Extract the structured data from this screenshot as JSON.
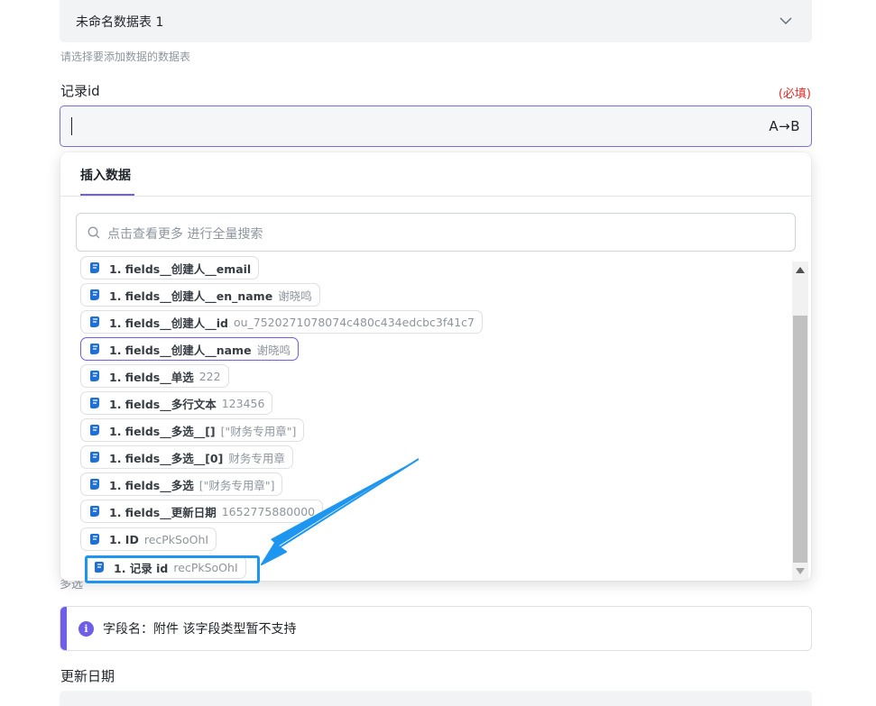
{
  "table_select": {
    "value": "未命名数据表 1",
    "hint": "请选择要添加数据的数据表"
  },
  "record_field": {
    "label": "记录id",
    "required": "(必填)",
    "value": "",
    "transform_label": "A→B"
  },
  "dropdown": {
    "tab": "插入数据",
    "search_placeholder": "点击查看更多 进行全量搜索",
    "items": [
      {
        "name": "1. fields__创建人__email",
        "value": ""
      },
      {
        "name": "1. fields__创建人__en_name",
        "value": "谢晓鸣"
      },
      {
        "name": "1. fields__创建人__id",
        "value": "ou_7520271078074c480c434edcbc3f41c7"
      },
      {
        "name": "1. fields__创建人__name",
        "value": "谢晓鸣"
      },
      {
        "name": "1. fields__单选",
        "value": "222"
      },
      {
        "name": "1. fields__多行文本",
        "value": "123456"
      },
      {
        "name": "1. fields__多选__[]",
        "value": "[\"财务专用章\"]"
      },
      {
        "name": "1. fields__多选__[0]",
        "value": "财务专用章"
      },
      {
        "name": "1. fields__多选",
        "value": "[\"财务专用章\"]"
      },
      {
        "name": "1. fields__更新日期",
        "value": "1652775880000"
      },
      {
        "name": "1. ID",
        "value": "recPkSoOhI"
      },
      {
        "name": "1. 记录 id",
        "value": "recPkSoOhI"
      }
    ]
  },
  "page_below": {
    "partial_label": "多选",
    "notice_text": "字段名：附件 该字段类型暂不支持",
    "update_label": "更新日期"
  },
  "colors": {
    "accent": "#6f5ee8",
    "annotation": "#1e96f0",
    "required": "#e02b2b"
  }
}
